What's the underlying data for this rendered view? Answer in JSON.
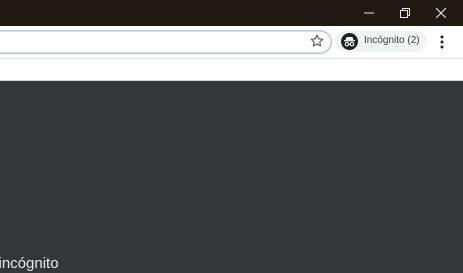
{
  "window": {
    "minimize_icon": "minimize-icon",
    "restore_icon": "restore-icon",
    "close_icon": "close-icon"
  },
  "toolbar": {
    "bookmark_icon": "star-icon",
    "profile": {
      "icon": "incognito-icon",
      "label": "Incógnito (2)"
    },
    "menu_icon": "kebab-menu-icon"
  },
  "page": {
    "headline": "o incógnito"
  },
  "colors": {
    "titlebar": "#201a12",
    "toolbar": "#ffffff",
    "content_bg": "#35363a",
    "omnibox_border": "#b6c5e0",
    "text_light": "#e8eaed"
  }
}
